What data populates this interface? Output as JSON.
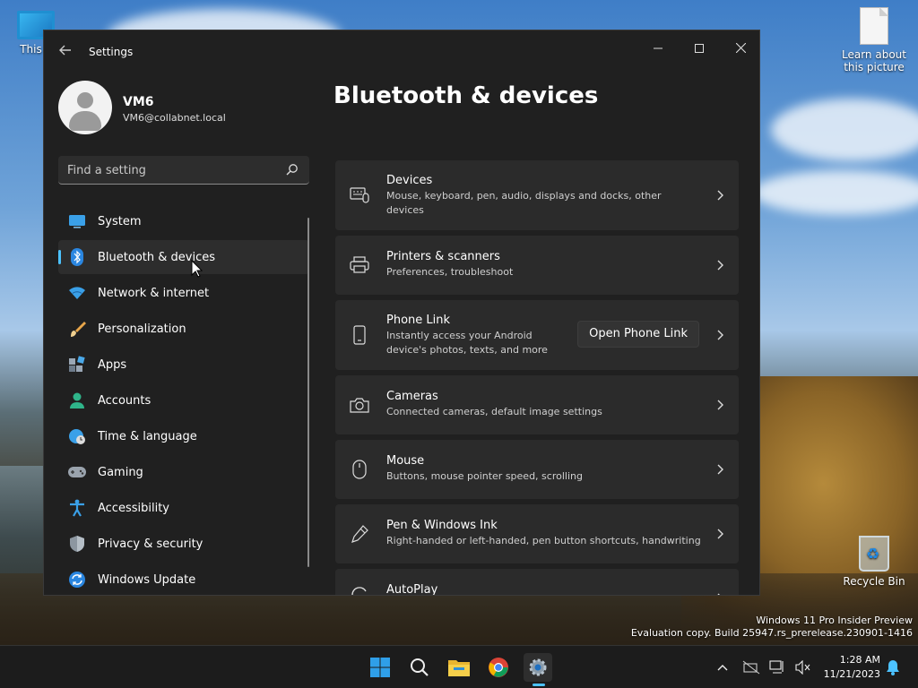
{
  "desktop": {
    "icons": [
      {
        "label": "This P"
      },
      {
        "label": "Learn about this picture"
      },
      {
        "label": "Recycle Bin"
      }
    ],
    "watermark": {
      "line1": "Windows 11 Pro Insider Preview",
      "line2": "Evaluation copy. Build 25947.rs_prerelease.230901-1416"
    }
  },
  "window": {
    "title": "Settings",
    "back_icon": "back-arrow-icon",
    "controls": [
      "minimize",
      "maximize",
      "close"
    ]
  },
  "profile": {
    "name": "VM6",
    "email": "VM6@collabnet.local"
  },
  "search": {
    "placeholder": "Find a setting"
  },
  "sidebar": {
    "items": [
      {
        "label": "System",
        "icon": "system-icon",
        "active": false
      },
      {
        "label": "Bluetooth & devices",
        "icon": "bluetooth-icon",
        "active": true
      },
      {
        "label": "Network & internet",
        "icon": "wifi-icon",
        "active": false
      },
      {
        "label": "Personalization",
        "icon": "brush-icon",
        "active": false
      },
      {
        "label": "Apps",
        "icon": "apps-icon",
        "active": false
      },
      {
        "label": "Accounts",
        "icon": "accounts-icon",
        "active": false
      },
      {
        "label": "Time & language",
        "icon": "globe-clock-icon",
        "active": false
      },
      {
        "label": "Gaming",
        "icon": "gamepad-icon",
        "active": false
      },
      {
        "label": "Accessibility",
        "icon": "accessibility-icon",
        "active": false
      },
      {
        "label": "Privacy & security",
        "icon": "shield-icon",
        "active": false
      },
      {
        "label": "Windows Update",
        "icon": "update-icon",
        "active": false
      }
    ]
  },
  "main": {
    "title": "Bluetooth & devices",
    "cards": [
      {
        "title": "Devices",
        "subtitle_lines": [
          "Mouse, keyboard, pen, audio, displays and docks, other",
          "devices"
        ],
        "icon": "devices-icon"
      },
      {
        "title": "Printers & scanners",
        "subtitle_lines": [
          "Preferences, troubleshoot"
        ],
        "icon": "printer-icon"
      },
      {
        "title": "Phone Link",
        "subtitle_lines": [
          "Instantly access your Android",
          "device's photos, texts, and more"
        ],
        "icon": "phone-icon",
        "button": "Open Phone Link"
      },
      {
        "title": "Cameras",
        "subtitle_lines": [
          "Connected cameras, default image settings"
        ],
        "icon": "camera-icon"
      },
      {
        "title": "Mouse",
        "subtitle_lines": [
          "Buttons, mouse pointer speed, scrolling"
        ],
        "icon": "mouse-icon"
      },
      {
        "title": "Pen & Windows Ink",
        "subtitle_lines": [
          "Right-handed or left-handed, pen button shortcuts, handwriting"
        ],
        "icon": "pen-icon"
      },
      {
        "title": "AutoPlay",
        "subtitle_lines": [],
        "icon": "autoplay-icon"
      }
    ]
  },
  "taskbar": {
    "apps": [
      "start",
      "search",
      "file-explorer",
      "chrome",
      "settings"
    ],
    "active_app": "settings",
    "clock": {
      "time": "1:28 AM",
      "date": "11/21/2023"
    }
  },
  "colors": {
    "accent": "#4cc2ff",
    "window_bg": "#202020",
    "card_bg": "#2b2b2b"
  }
}
